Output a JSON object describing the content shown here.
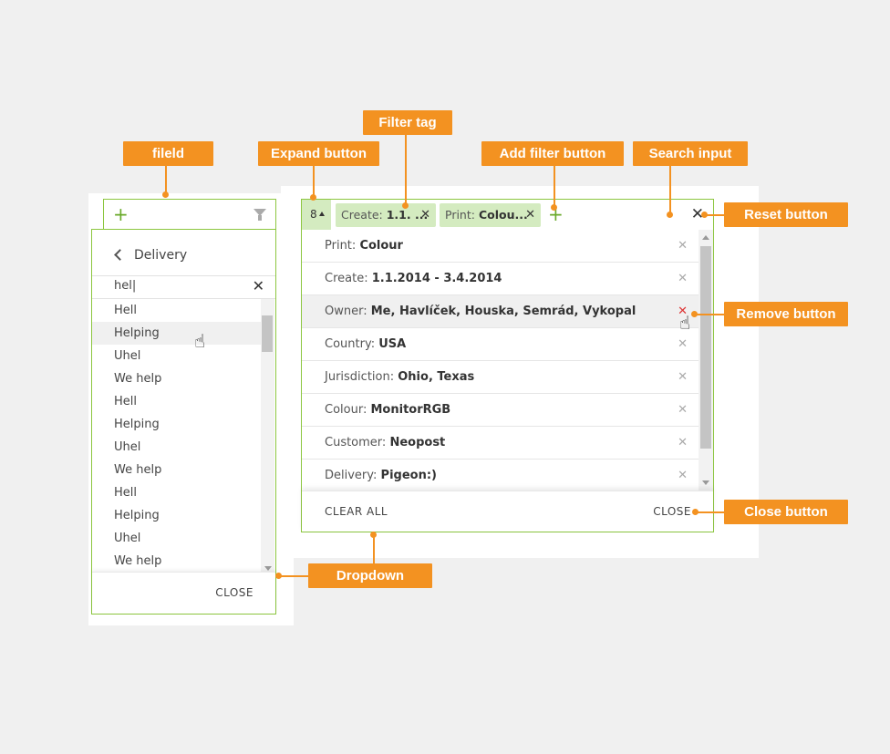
{
  "left_widget": {
    "field_icons": {
      "add": "plus-icon",
      "filter": "funnel-icon"
    },
    "dropdown": {
      "header_title": "Delivery",
      "search_value": "hel|",
      "items": [
        "Hell",
        "Helping",
        "Uhel",
        "We help",
        "Hell",
        "Helping",
        "Uhel",
        "We help",
        "Hell",
        "Helping",
        "Uhel",
        "We help"
      ],
      "highlighted_index": 1,
      "close_label": "CLOSE"
    }
  },
  "right_widget": {
    "expand": {
      "count": "8"
    },
    "tags": [
      {
        "label": "Create:",
        "value": "1.1. ..."
      },
      {
        "label": "Print:",
        "value": "Colou..."
      }
    ],
    "filters": [
      {
        "label": "Print:",
        "value": "Colour"
      },
      {
        "label": "Create:",
        "value": "1.1.2014 - 3.4.2014"
      },
      {
        "label": "Owner:",
        "value": "Me, Havlíček, Houska, Semrád, Vykopal"
      },
      {
        "label": "Country:",
        "value": "USA"
      },
      {
        "label": "Jurisdiction:",
        "value": "Ohio, Texas"
      },
      {
        "label": "Colour:",
        "value": "MonitorRGB"
      },
      {
        "label": "Customer:",
        "value": "Neopost"
      },
      {
        "label": "Delivery:",
        "value": "Pigeon:)"
      }
    ],
    "highlighted_filter_index": 2,
    "clear_all_label": "CLEAR ALL",
    "close_label": "CLOSE"
  },
  "callouts": {
    "field": "fileld",
    "expand_button": "Expand button",
    "filter_tag": "Filter tag",
    "add_filter_button": "Add filter button",
    "search_input": "Search input",
    "reset_button": "Reset button",
    "remove_button": "Remove button",
    "close_button": "Close button",
    "dropdown": "Dropdown"
  },
  "colors": {
    "accent": "#f39221",
    "border_green": "#8cc63f",
    "tag_green": "#d4ebc0",
    "remove_red": "#d33333"
  }
}
